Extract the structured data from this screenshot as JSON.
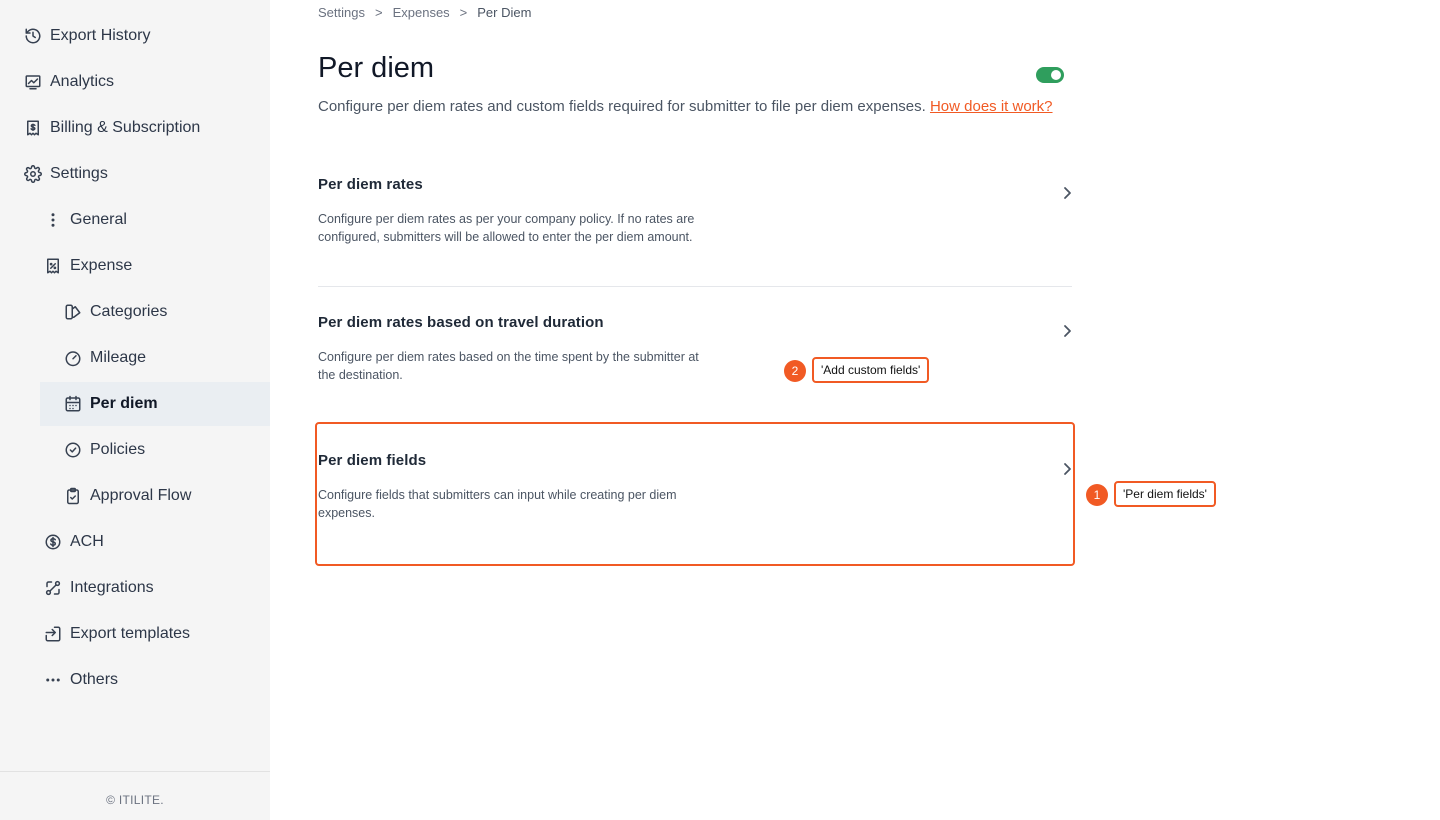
{
  "sidebar": {
    "items": [
      {
        "label": "Export History",
        "icon": "history-icon"
      },
      {
        "label": "Analytics",
        "icon": "analytics-icon"
      },
      {
        "label": "Billing & Subscription",
        "icon": "receipt-icon"
      },
      {
        "label": "Settings",
        "icon": "gear-icon"
      },
      {
        "label": "General",
        "icon": "more-vertical-icon"
      },
      {
        "label": "Expense",
        "icon": "expense-receipt-icon"
      },
      {
        "label": "Categories",
        "icon": "categories-icon"
      },
      {
        "label": "Mileage",
        "icon": "speedometer-icon"
      },
      {
        "label": "Per diem",
        "icon": "calendar-icon",
        "active": true
      },
      {
        "label": "Policies",
        "icon": "shield-check-icon"
      },
      {
        "label": "Approval Flow",
        "icon": "clipboard-check-icon"
      },
      {
        "label": "ACH",
        "icon": "dollar-circle-icon"
      },
      {
        "label": "Integrations",
        "icon": "integrations-icon"
      },
      {
        "label": "Export templates",
        "icon": "export-icon"
      },
      {
        "label": "Others",
        "icon": "more-horizontal-icon"
      }
    ],
    "footer": "© ITILITE."
  },
  "breadcrumb": {
    "items": [
      "Settings",
      "Expenses",
      "Per Diem"
    ],
    "separator": ">"
  },
  "header": {
    "title": "Per diem",
    "toggle_on": true,
    "description": "Configure per diem rates and custom fields required for submitter to file per diem expenses.",
    "help_link": "How does it work?"
  },
  "cards": [
    {
      "title": "Per diem rates",
      "description": "Configure per diem rates as per your company policy. If no rates are configured, submitters will be allowed to enter the per diem amount."
    },
    {
      "title": "Per diem rates based on travel duration",
      "description": "Configure per diem rates based on the time spent by the submitter at the destination."
    },
    {
      "title": "Per diem fields",
      "description": "Configure fields that submitters can input while creating per diem expenses."
    }
  ],
  "annotations": [
    {
      "number": "1",
      "label": "'Per diem fields'"
    },
    {
      "number": "2",
      "label": "'Add custom fields'"
    }
  ],
  "colors": {
    "accent": "#f15a24",
    "toggle": "#2f9e5d",
    "sidebar_bg": "#f5f5f5",
    "active_bg": "#eaeef2"
  }
}
